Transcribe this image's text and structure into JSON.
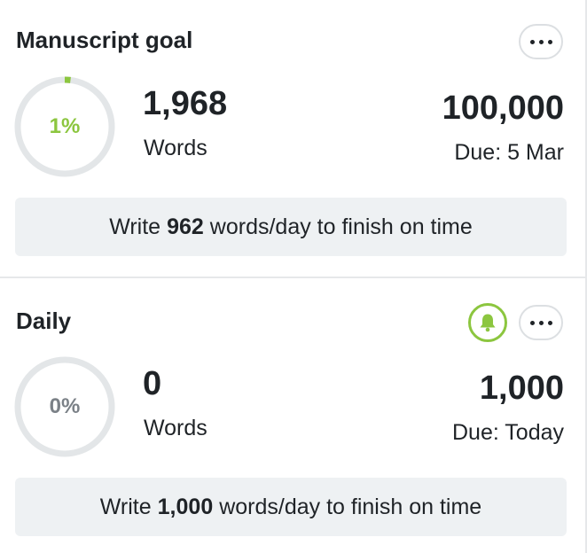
{
  "manuscript": {
    "title": "Manuscript goal",
    "percent_label": "1%",
    "progress": 0.0197,
    "count": "1,968",
    "unit": "Words",
    "target": "100,000",
    "due": "Due: 5 Mar",
    "banner": {
      "prefix": "Write",
      "value": "962",
      "suffix": "words/day to finish on time"
    },
    "menu_icon": "more-horizontal-icon"
  },
  "daily": {
    "title": "Daily",
    "percent_label": "0%",
    "progress": 0,
    "count": "0",
    "unit": "Words",
    "target": "1,000",
    "due": "Due: Today",
    "banner": {
      "prefix": "Write",
      "value": "1,000",
      "suffix": "words/day to finish on time"
    },
    "menu_icon": "more-horizontal-icon",
    "reminder_icon": "bell-icon"
  },
  "colors": {
    "accent": "#8cc63f",
    "ring_track": "#e3e6e8",
    "text": "#1f2327",
    "muted": "#7b8187",
    "banner_bg": "#eef1f3"
  }
}
